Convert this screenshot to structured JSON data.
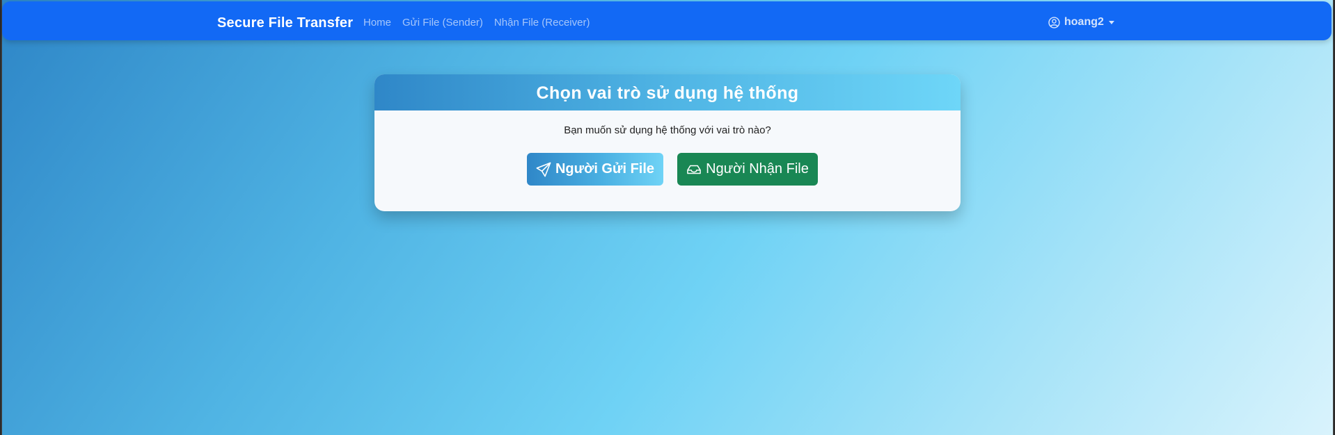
{
  "navbar": {
    "brand": "Secure File Transfer",
    "links": [
      {
        "label": "Home"
      },
      {
        "label": "Gửi File (Sender)"
      },
      {
        "label": "Nhận File (Receiver)"
      }
    ],
    "user": {
      "name": "hoang2",
      "icon": "user-circle-icon"
    }
  },
  "card": {
    "title": "Chọn vai trò sử dụng hệ thống",
    "prompt": "Bạn muốn sử dụng hệ thống với vai trò nào?",
    "buttons": {
      "sender": {
        "label": "Người Gửi File",
        "icon": "send-icon"
      },
      "receiver": {
        "label": "Người Nhận File",
        "icon": "inbox-icon"
      }
    }
  },
  "colors": {
    "navbar": "#1269f5",
    "receiver_button": "#198754",
    "gradient_start": "#2e86c7",
    "gradient_end": "#d9f3fc"
  }
}
